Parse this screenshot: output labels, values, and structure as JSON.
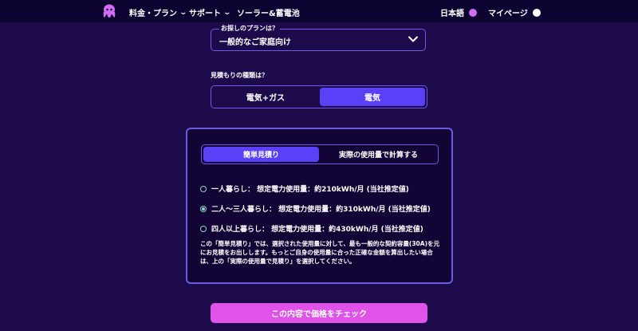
{
  "nav": {
    "items": [
      {
        "label": "料金・プラン"
      },
      {
        "label": "サポート"
      },
      {
        "label": "ソーラー&蓄電池"
      }
    ],
    "language": "日本語",
    "mypage": "マイページ",
    "icons": {
      "logo": "octopus-logo-icon",
      "chevron": "chevron-down-icon",
      "lang": "globe-icon",
      "user": "user-icon"
    },
    "colors": {
      "bg": "#0d0330",
      "logo": "#d36cf2"
    }
  },
  "plan": {
    "label": "お探しのプランは？",
    "selected": "一般的なご家庭向け"
  },
  "estimate": {
    "label": "見積もりの種類は？",
    "options": [
      {
        "label": "電気+ガス",
        "selected": false
      },
      {
        "label": "電気",
        "selected": true
      }
    ]
  },
  "panel": {
    "tabs": [
      {
        "label": "簡単見積り",
        "selected": true
      },
      {
        "label": "実際の使用量で計算する",
        "selected": false
      }
    ],
    "options": [
      {
        "label": "一人暮らし： 想定電力使用量：約210kWh/月 (当社推定値)",
        "selected": false
      },
      {
        "label": "二人〜三人暮らし： 想定電力使用量：約310kWh/月 (当社推定値)",
        "selected": true
      },
      {
        "label": "四人以上暮らし： 想定電力使用量：約430kWh/月 (当社推定値)",
        "selected": false
      }
    ],
    "note": "この「簡単見積り」では、選択された使用量に対して、最も一般的な契約容量(30A)を元にお見積をお出しします。もっとご自身の使用量に合った正確な金額を算出したい場合は、上の「実際の使用量で見積り」を選択してください。"
  },
  "cta": {
    "label": "この内容で価格をチェック"
  },
  "colors": {
    "page_bg": "#1c0a4a",
    "accent": "#5a41f7",
    "border": "#6d5be8",
    "cta": "#e052e8",
    "radio": "#8fd3c8"
  }
}
